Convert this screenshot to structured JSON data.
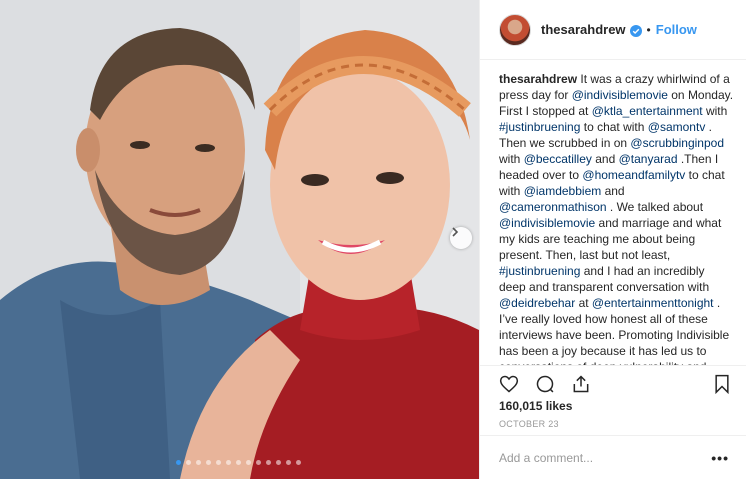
{
  "header": {
    "username": "thesarahdrew",
    "separator": "•",
    "follow_label": "Follow",
    "avatar_icon": "avatar-icon",
    "verified_icon": "verified-badge-icon"
  },
  "caption": {
    "author": "thesarahdrew",
    "segments": [
      {
        "t": " It was a crazy whirlwind of a press day for "
      },
      {
        "t": "@indivisiblemovie",
        "link": true
      },
      {
        "t": " on Monday. First I stopped at "
      },
      {
        "t": "@ktla_entertainment",
        "link": true
      },
      {
        "t": " with "
      },
      {
        "t": "#justinbruening",
        "link": true
      },
      {
        "t": " to chat with "
      },
      {
        "t": "@samontv",
        "link": true
      },
      {
        "t": " . Then we scrubbed in on "
      },
      {
        "t": "@scrubbinginpod",
        "link": true
      },
      {
        "t": " with "
      },
      {
        "t": "@beccatilley",
        "link": true
      },
      {
        "t": " and "
      },
      {
        "t": "@tanyarad",
        "link": true
      },
      {
        "t": " .Then I headed over to "
      },
      {
        "t": "@homeandfamilytv",
        "link": true
      },
      {
        "t": " to chat with "
      },
      {
        "t": "@iamdebbiem",
        "link": true
      },
      {
        "t": " and "
      },
      {
        "t": "@cameronmathison",
        "link": true
      },
      {
        "t": " . We talked about "
      },
      {
        "t": "@indivisiblemovie",
        "link": true
      },
      {
        "t": " and marriage and what my kids are teaching me about being present. Then, last but not least, "
      },
      {
        "t": "#justinbruening",
        "link": true
      },
      {
        "t": " and I had an incredibly deep and transparent conversation with "
      },
      {
        "t": "@deidrebehar",
        "link": true
      },
      {
        "t": " at "
      },
      {
        "t": "@entertainmenttonight",
        "link": true
      },
      {
        "t": " . I’ve really loved how honest all of these interviews have been. Promoting Indivisible has been a joy because it has led us to conversations of deep vulnerability and transparency about relationships and parenthood and how we"
      }
    ]
  },
  "actions": {
    "like_icon": "heart-icon",
    "comment_icon": "comment-icon",
    "share_icon": "share-icon",
    "save_icon": "bookmark-icon"
  },
  "likes_text": "160,015 likes",
  "date_text": "OCTOBER 23",
  "comment": {
    "placeholder": "Add a comment...",
    "more_label": "•••"
  },
  "carousel": {
    "slide_count": 13,
    "active_index": 0,
    "next_icon": "chevron-right-icon"
  },
  "colors": {
    "link": "#003569",
    "accent": "#3897f0",
    "muted": "#999999"
  }
}
